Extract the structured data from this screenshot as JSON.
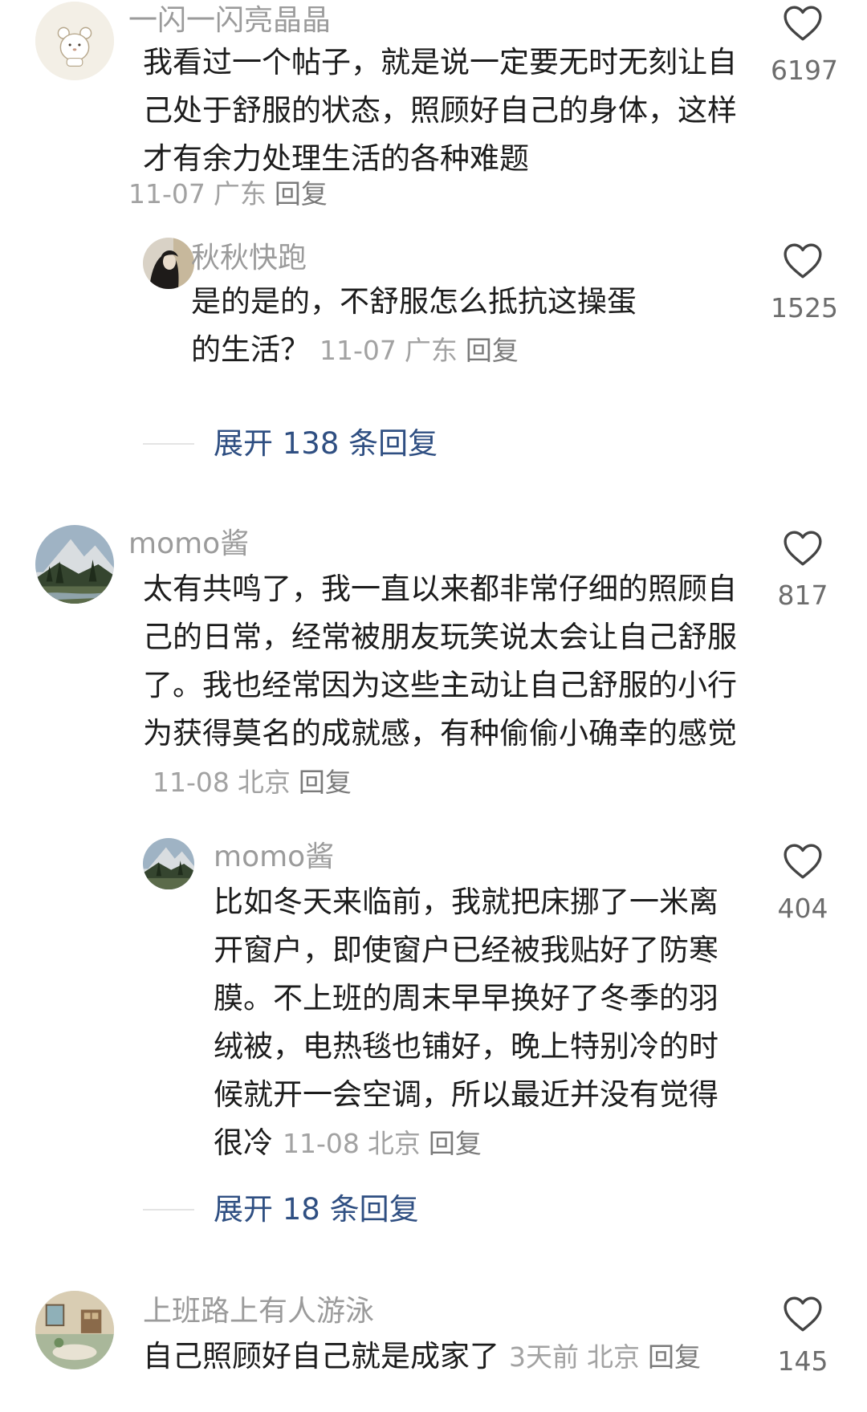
{
  "comments": [
    {
      "user": "一闪一闪亮晶晶",
      "avatar": "cartoon-bear-avatar",
      "text": "我看过一个帖子，就是说一定要无时无刻让自己处于舒服的状态，照顾好自己的身体，这样才有余力处理生活的各种难题",
      "date": "11-07",
      "location": "广东",
      "reply_label": "回复",
      "likes": "6197",
      "reply": {
        "user": "秋秋快跑",
        "avatar": "dark-portrait-avatar",
        "text": "是的是的，不舒服怎么抵抗这操蛋的生活？",
        "date": "11-07",
        "location": "广东",
        "reply_label": "回复",
        "likes": "1525"
      },
      "expand_label": "展开 138 条回复"
    },
    {
      "user": "momo酱",
      "avatar": "mountain-landscape-avatar",
      "text": "太有共鸣了，我一直以来都非常仔细的照顾自己的日常，经常被朋友玩笑说太会让自己舒服了。我也经常因为这些主动让自己舒服的小行为获得莫名的成就感，有种偷偷小确幸的感觉",
      "date": "11-08",
      "location": "北京",
      "reply_label": "回复",
      "likes": "817",
      "reply": {
        "user": "momo酱",
        "avatar": "mountain-landscape-avatar",
        "text": "比如冬天来临前，我就把床挪了一米离开窗户，即使窗户已经被我贴好了防寒膜。不上班的周末早早换好了冬季的羽绒被，电热毯也铺好，晚上特别冷的时候就开一会空调，所以最近并没有觉得很冷",
        "date": "11-08",
        "location": "北京",
        "reply_label": "回复",
        "likes": "404"
      },
      "expand_label": "展开 18 条回复"
    },
    {
      "user": "上班路上有人游泳",
      "avatar": "room-illustration-avatar",
      "text": "自己照顾好自己就是成家了",
      "date": "3天前",
      "location": "北京",
      "reply_label": "回复",
      "likes": "145"
    }
  ],
  "colors": {
    "text": "#1c1c1c",
    "username": "#9b9b9b",
    "meta": "#a2a2a2",
    "expand_link": "#2f4f82",
    "like_icon": "#444444"
  },
  "icons": {
    "like": "heart-outline-icon"
  }
}
